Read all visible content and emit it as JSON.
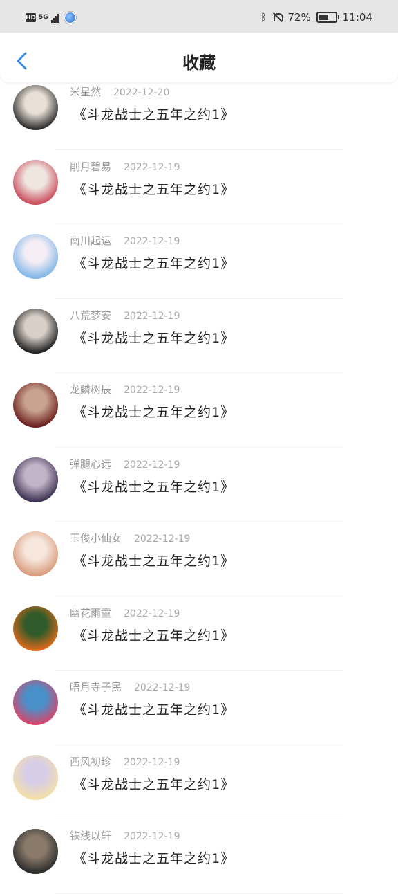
{
  "status": {
    "network_label": "HD",
    "network_type": "5G",
    "battery_text": "72%",
    "battery_level": 0.72,
    "time": "11:04"
  },
  "header": {
    "title": "收藏",
    "back_icon": "chevron-left-icon",
    "accent_color": "#3a8ee6"
  },
  "items": [
    {
      "name": "米星然",
      "date": "2022-12-20",
      "book": "《斗龙战士之五年之约1》",
      "avatar_colors": [
        "#2b2b2b",
        "#e8e0d6"
      ]
    },
    {
      "name": "削月碧易",
      "date": "2022-12-19",
      "book": "《斗龙战士之五年之约1》",
      "avatar_colors": [
        "#c94a5a",
        "#efe6e0"
      ]
    },
    {
      "name": "南川起运",
      "date": "2022-12-19",
      "book": "《斗龙战士之五年之约1》",
      "avatar_colors": [
        "#7fb5e8",
        "#f4eef4"
      ]
    },
    {
      "name": "八荒梦安",
      "date": "2022-12-19",
      "book": "《斗龙战士之五年之约1》",
      "avatar_colors": [
        "#1d1d1d",
        "#d8cfc8"
      ]
    },
    {
      "name": "龙鳞树辰",
      "date": "2022-12-19",
      "book": "《斗龙战士之五年之约1》",
      "avatar_colors": [
        "#6a1e1e",
        "#c9a38f"
      ]
    },
    {
      "name": "弹腿心远",
      "date": "2022-12-19",
      "book": "《斗龙战士之五年之约1》",
      "avatar_colors": [
        "#3a3050",
        "#c2b4c8"
      ]
    },
    {
      "name": "玉俊小仙女",
      "date": "2022-12-19",
      "book": "《斗龙战士之五年之约1》",
      "avatar_colors": [
        "#d89a7a",
        "#f6e6dc"
      ]
    },
    {
      "name": "幽花雨童",
      "date": "2022-12-19",
      "book": "《斗龙战士之五年之约1》",
      "avatar_colors": [
        "#e06a1a",
        "#2f5a2a"
      ]
    },
    {
      "name": "晤月寺子民",
      "date": "2022-12-19",
      "book": "《斗龙战士之五年之约1》",
      "avatar_colors": [
        "#d8456a",
        "#4a90c8"
      ]
    },
    {
      "name": "西风初珍",
      "date": "2022-12-19",
      "book": "《斗龙战士之五年之约1》",
      "avatar_colors": [
        "#f3e0a8",
        "#d8cde8"
      ]
    },
    {
      "name": "铁线以轩",
      "date": "2022-12-19",
      "book": "《斗龙战士之五年之约1》",
      "avatar_colors": [
        "#2a2a2a",
        "#8a7a6a"
      ]
    }
  ]
}
